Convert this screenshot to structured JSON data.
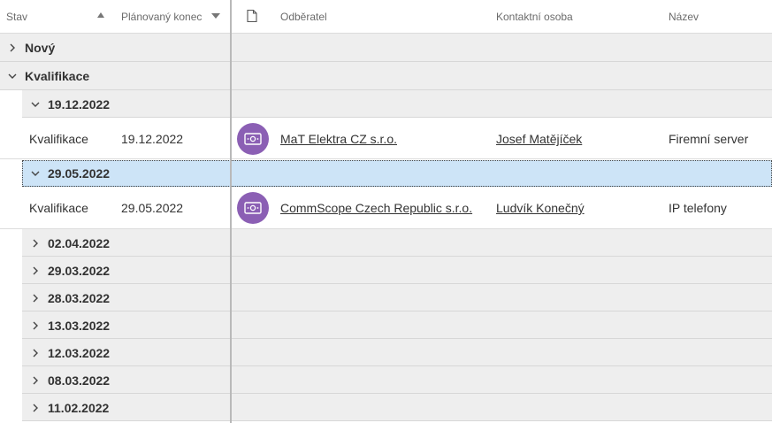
{
  "columns": {
    "stav": "Stav",
    "planovany_konec": "Plánovaný konec",
    "odberatel": "Odběratel",
    "kontaktni_osoba": "Kontaktní osoba",
    "nazev": "Název"
  },
  "groups": {
    "novy": "Nový",
    "kvalifikace": "Kvalifikace"
  },
  "subgroups": [
    "19.12.2022",
    "29.05.2022",
    "02.04.2022",
    "29.03.2022",
    "28.03.2022",
    "13.03.2022",
    "12.03.2022",
    "08.03.2022",
    "11.02.2022"
  ],
  "rows": [
    {
      "stav": "Kvalifikace",
      "konec": "19.12.2022",
      "odberatel": "MaT Elektra CZ s.r.o.",
      "kontakt": "Josef Matějíček",
      "nazev": "Firemní server"
    },
    {
      "stav": "Kvalifikace",
      "konec": "29.05.2022",
      "odberatel": "CommScope Czech Republic s.r.o.",
      "kontakt": "Ludvík Konečný",
      "nazev": "IP telefony"
    }
  ],
  "colors": {
    "accent_avatar": "#8b5fb4",
    "selected_row": "#cde4f7",
    "group_bg": "#eeeeee"
  },
  "icons": {
    "row_avatar": "money-icon",
    "header_document": "document-icon"
  }
}
